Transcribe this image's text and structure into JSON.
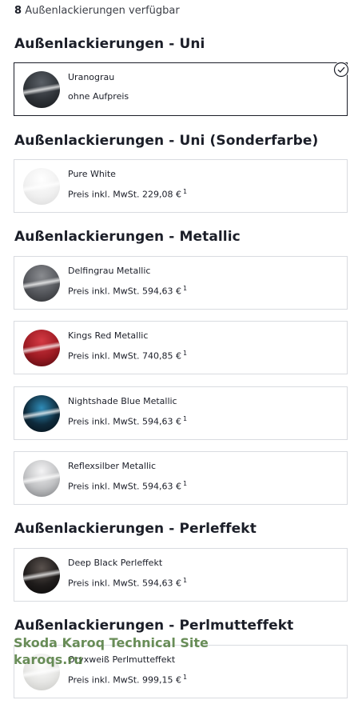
{
  "header": {
    "count": "8",
    "count_label": "Außenlackierungen verfügbar"
  },
  "sections": [
    {
      "title": "Außenlackierungen - Uni",
      "items": [
        {
          "name": "Uranograu",
          "price": "ohne Aufpreis",
          "footnote": "",
          "selected": true,
          "color": "#2f3338"
        }
      ]
    },
    {
      "title": "Außenlackierungen - Uni (Sonderfarbe)",
      "items": [
        {
          "name": "Pure White",
          "price": "Preis inkl. MwSt. 229,08 €",
          "footnote": "1",
          "selected": false,
          "color": "#f2f2f2"
        }
      ]
    },
    {
      "title": "Außenlackierungen - Metallic",
      "items": [
        {
          "name": "Delfingrau Metallic",
          "price": "Preis inkl. MwSt. 594,63 €",
          "footnote": "1",
          "selected": false,
          "color": "#55575c"
        },
        {
          "name": "Kings Red Metallic",
          "price": "Preis inkl. MwSt. 740,85 €",
          "footnote": "1",
          "selected": false,
          "color": "#9c1a22"
        },
        {
          "name": "Nightshade Blue Metallic",
          "price": "Preis inkl. MwSt. 594,63 €",
          "footnote": "1",
          "selected": false,
          "color": "#0e2a3b"
        },
        {
          "name": "Reflexsilber Metallic",
          "price": "Preis inkl. MwSt. 594,63 €",
          "footnote": "1",
          "selected": false,
          "color": "#bfc0c2"
        }
      ]
    },
    {
      "title": "Außenlackierungen - Perleffekt",
      "items": [
        {
          "name": "Deep Black Perleffekt",
          "price": "Preis inkl. MwSt. 594,63 €",
          "footnote": "1",
          "selected": false,
          "color": "#1f1c1b"
        }
      ]
    },
    {
      "title": "Außenlackierungen - Perlmutteffekt",
      "items": [
        {
          "name": "Oryxweiß Perlmutteffekt",
          "price": "Preis inkl. MwSt. 999,15 €",
          "footnote": "1",
          "selected": false,
          "color": "#e6e6e4"
        }
      ]
    }
  ],
  "icons": {
    "selected": "check-circle-icon"
  },
  "watermark": {
    "line1": "Skoda Karoq Technical Site",
    "line2": "karoqs.ru"
  }
}
